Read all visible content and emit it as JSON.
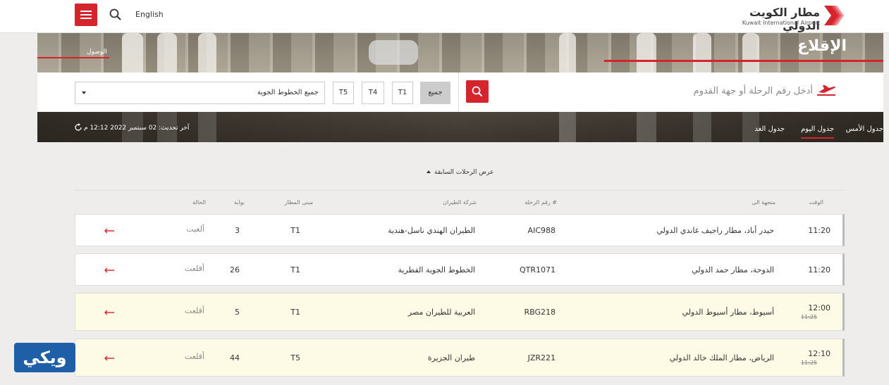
{
  "header": {
    "language_label": "English",
    "logo_ar": "مطار الكويت الدولي",
    "logo_en": "Kuwait International Airport",
    "brand_color": "#d6242d",
    "menu_icon": "hamburger-icon",
    "search_icon": "search-icon"
  },
  "hero": {
    "arrivals_label": "الوصول",
    "departures_title": "الإقلاع"
  },
  "filters": {
    "flight_search_placeholder": "أدخل رقم الرحلة أو جهة القدوم",
    "terminals": [
      "جميع",
      "T1",
      "T4",
      "T5"
    ],
    "selected_terminal": "جميع",
    "airline_selected": "جميع الخطوط الجوية"
  },
  "days": {
    "tabs": [
      "جدول الأمس",
      "جدول اليوم",
      "جدول الغد"
    ],
    "active": "جدول اليوم",
    "last_updated": "آخر تحديث: 02 سبتمبر 2022 12:12 م"
  },
  "table": {
    "show_previous": "عرض الرحلات السابقة",
    "headers": {
      "time": "الوقت",
      "destination": "متجهة الى",
      "flight": "رقم الرحلة #",
      "airline": "شركة الطيران",
      "terminal": "مبنى المطار",
      "gate": "بوابة",
      "status": "الحالة"
    },
    "rows": [
      {
        "time": "11:20",
        "old_time": "",
        "destination": "حيدر أباد، مطار راجيف غاندي الدولي",
        "flight": "AIC988",
        "airline": "الطيران الهندي ناسل-هندية",
        "terminal": "T1",
        "gate": "3",
        "status": "ألغيت",
        "delayed": false
      },
      {
        "time": "11:20",
        "old_time": "",
        "destination": "الدوحة، مطار حمد الدولي",
        "flight": "QTR1071",
        "airline": "الخطوط الجوية القطرية",
        "terminal": "T1",
        "gate": "26",
        "status": "أقلعت",
        "delayed": false
      },
      {
        "time": "12:00",
        "old_time": "11:25",
        "destination": "أسيوط، مطار أسيوط الدولي",
        "flight": "RBG218",
        "airline": "العربية للطيران مصر",
        "terminal": "T1",
        "gate": "5",
        "status": "أقلعت",
        "delayed": true
      },
      {
        "time": "12:10",
        "old_time": "11:25",
        "destination": "الرياض، مطار الملك خالد الدولي",
        "flight": "JZR221",
        "airline": "طيران الجزيرة",
        "terminal": "T5",
        "gate": "44",
        "status": "أقلعت",
        "delayed": true
      }
    ]
  },
  "watermark": {
    "text": "ويكي"
  }
}
